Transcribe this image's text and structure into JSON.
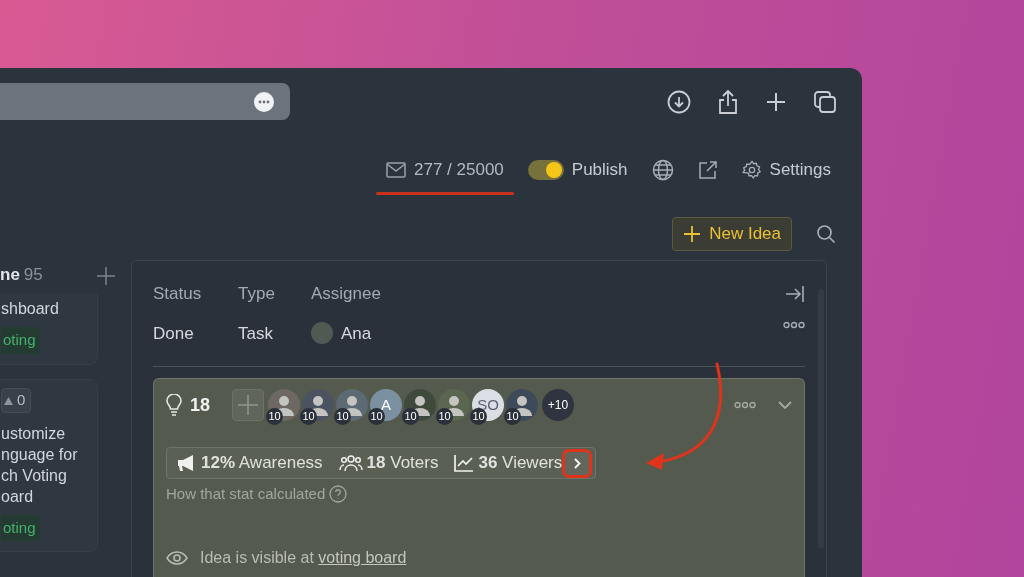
{
  "header": {
    "email_count": "277 / 25000",
    "publish": {
      "label": "Publish",
      "on": true
    },
    "settings": "Settings"
  },
  "new_idea": "New Idea",
  "column": {
    "title": "ne",
    "count": "95",
    "cards": [
      {
        "lines": [
          "shboard"
        ],
        "tag": "oting"
      },
      {
        "votes": "0",
        "lines": [
          "ustomize",
          "nguage for",
          "ch Voting",
          "oard"
        ],
        "tag": "oting"
      }
    ]
  },
  "details": {
    "fields": [
      {
        "label": "Status",
        "value": "Done",
        "kind": "text"
      },
      {
        "label": "Type",
        "value": "Task",
        "kind": "text"
      },
      {
        "label": "Assignee",
        "value": "Ana",
        "kind": "person"
      }
    ]
  },
  "idea": {
    "count": "18",
    "voters": [
      {
        "kind": "photo",
        "badge": "10"
      },
      {
        "kind": "photo",
        "badge": "10"
      },
      {
        "kind": "photo",
        "badge": "10"
      },
      {
        "kind": "initials",
        "initials": "A",
        "color": "#7b91a1",
        "badge": "10"
      },
      {
        "kind": "photo",
        "badge": "10"
      },
      {
        "kind": "photo",
        "badge": "10"
      },
      {
        "kind": "initials",
        "initials": "SO",
        "color": "#dcdee6",
        "badge": "10"
      },
      {
        "kind": "photo",
        "badge": "10"
      }
    ],
    "more": "+10",
    "stats": [
      {
        "kind": "megaphone",
        "text": "**12%** Awareness"
      },
      {
        "kind": "people",
        "text": "**18** Voters"
      },
      {
        "kind": "chart",
        "text": "**36** Viewers"
      }
    ],
    "help": "How that stat calculated",
    "visibility": {
      "text": "Idea is visible at",
      "link": "voting board"
    }
  }
}
